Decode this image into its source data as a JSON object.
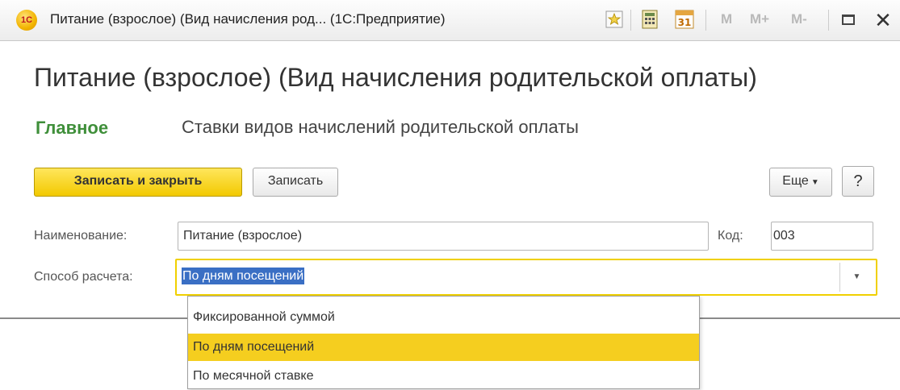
{
  "window": {
    "title": "Питание (взрослое) (Вид начисления род...  (1С:Предприятие)",
    "logo_text": "1С",
    "memory_buttons": [
      "M",
      "M+",
      "M-"
    ],
    "close_glyph": "✕",
    "calendar_day": "31"
  },
  "form": {
    "title": "Питание (взрослое) (Вид начисления родительской оплаты)",
    "tabs": [
      {
        "label": "Главное",
        "active": true
      },
      {
        "label": "Ставки видов начислений родительской оплаты",
        "active": false
      }
    ]
  },
  "toolbar": {
    "save_close_label": "Записать и закрыть",
    "save_label": "Записать",
    "more_label": "Еще",
    "help_label": "?"
  },
  "fields": {
    "name_label": "Наименование:",
    "name_value": "Питание (взрослое)",
    "code_label": "Код:",
    "code_value": "003",
    "method_label": "Способ расчета:",
    "method_value": "По дням посещений"
  },
  "dropdown": {
    "options": [
      "Фиксированной суммой",
      "По дням посещений",
      "По месячной ставке"
    ],
    "selected_index": 1
  },
  "colors": {
    "accent_yellow": "#f2c900",
    "tab_active_green": "#3f8f3a",
    "selection_blue": "#3a6fc4",
    "option_highlight": "#f5ce1f"
  }
}
